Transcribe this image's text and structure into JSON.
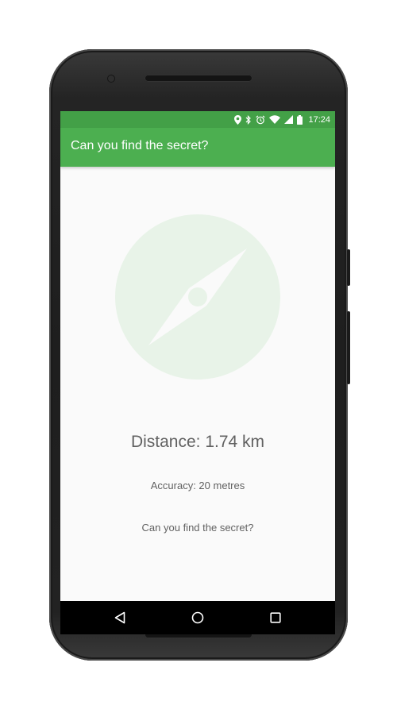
{
  "status_bar": {
    "time": "17:24",
    "icons": [
      "location-icon",
      "bluetooth-icon",
      "alarm-icon",
      "wifi-icon",
      "signal-icon",
      "battery-icon"
    ]
  },
  "app_bar": {
    "title": "Can you find the secret?"
  },
  "main": {
    "compass_icon": "compass-icon",
    "distance": "Distance: 1.74 km",
    "accuracy": "Accuracy: 20 metres",
    "hint": "Can you find the secret?"
  },
  "nav_bar": {
    "buttons": [
      "back-icon",
      "home-icon",
      "recents-icon"
    ]
  },
  "colors": {
    "primary": "#4caf50",
    "primary_dark": "#43a047",
    "compass_bg": "#e8f3e8",
    "text": "#616161"
  }
}
